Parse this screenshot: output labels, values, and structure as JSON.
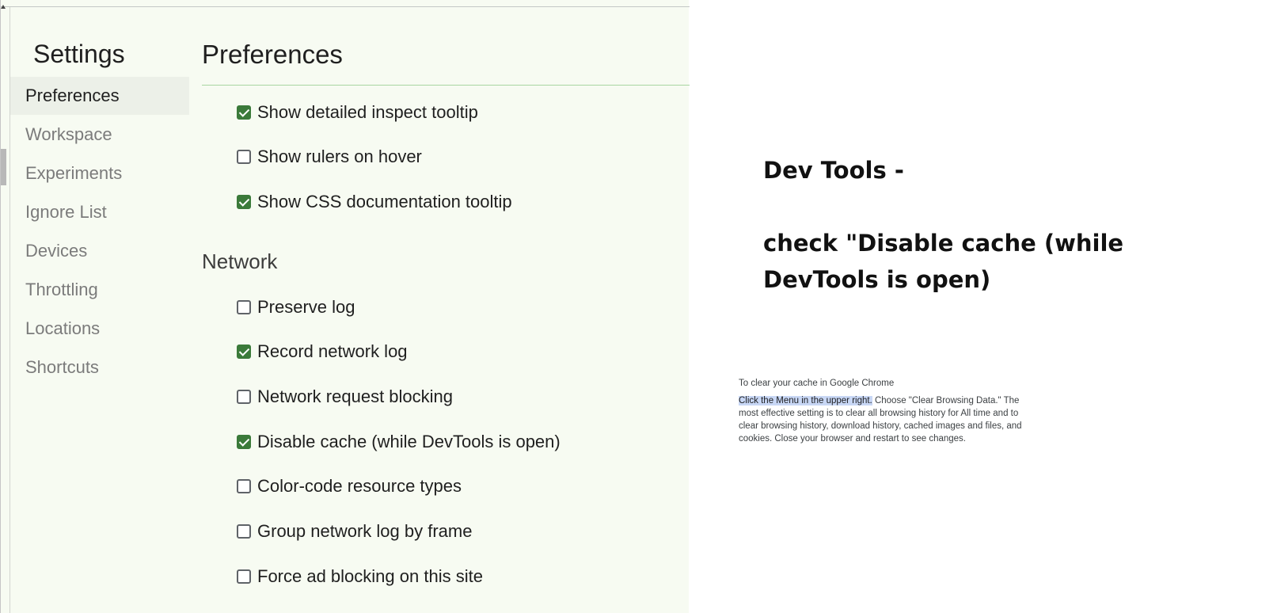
{
  "sidebar": {
    "title": "Settings",
    "items": [
      {
        "label": "Preferences",
        "selected": true
      },
      {
        "label": "Workspace",
        "selected": false
      },
      {
        "label": "Experiments",
        "selected": false
      },
      {
        "label": "Ignore List",
        "selected": false
      },
      {
        "label": "Devices",
        "selected": false
      },
      {
        "label": "Throttling",
        "selected": false
      },
      {
        "label": "Locations",
        "selected": false
      },
      {
        "label": "Shortcuts",
        "selected": false
      }
    ]
  },
  "main": {
    "title": "Preferences",
    "elements_settings": [
      {
        "label": "Show detailed inspect tooltip",
        "checked": true
      },
      {
        "label": "Show rulers on hover",
        "checked": false
      },
      {
        "label": "Show CSS documentation tooltip",
        "checked": true
      }
    ],
    "network": {
      "heading": "Network",
      "settings": [
        {
          "label": "Preserve log",
          "checked": false
        },
        {
          "label": "Record network log",
          "checked": true
        },
        {
          "label": "Network request blocking",
          "checked": false
        },
        {
          "label": "Disable cache (while DevTools is open)",
          "checked": true
        },
        {
          "label": "Color-code resource types",
          "checked": false
        },
        {
          "label": "Group network log by frame",
          "checked": false
        },
        {
          "label": "Force ad blocking on this site",
          "checked": false
        }
      ]
    }
  },
  "note": {
    "line1": "Dev Tools -",
    "line2": "check \"Disable cache (while",
    "line3": "DevTools is open)"
  },
  "instructions": {
    "heading": "To clear your cache in Google Chrome",
    "highlighted": "Click the Menu in the upper right.",
    "body": " Choose \"Clear Browsing Data.\" The most effective setting is to clear all browsing history for All time and to clear browsing history, download history, cached images and files, and cookies. Close your browser and restart to see changes."
  },
  "colors": {
    "checkbox_checked": "#3b7a3a",
    "panel_background": "#f7fbf2",
    "highlight": "#c8d7f5"
  }
}
